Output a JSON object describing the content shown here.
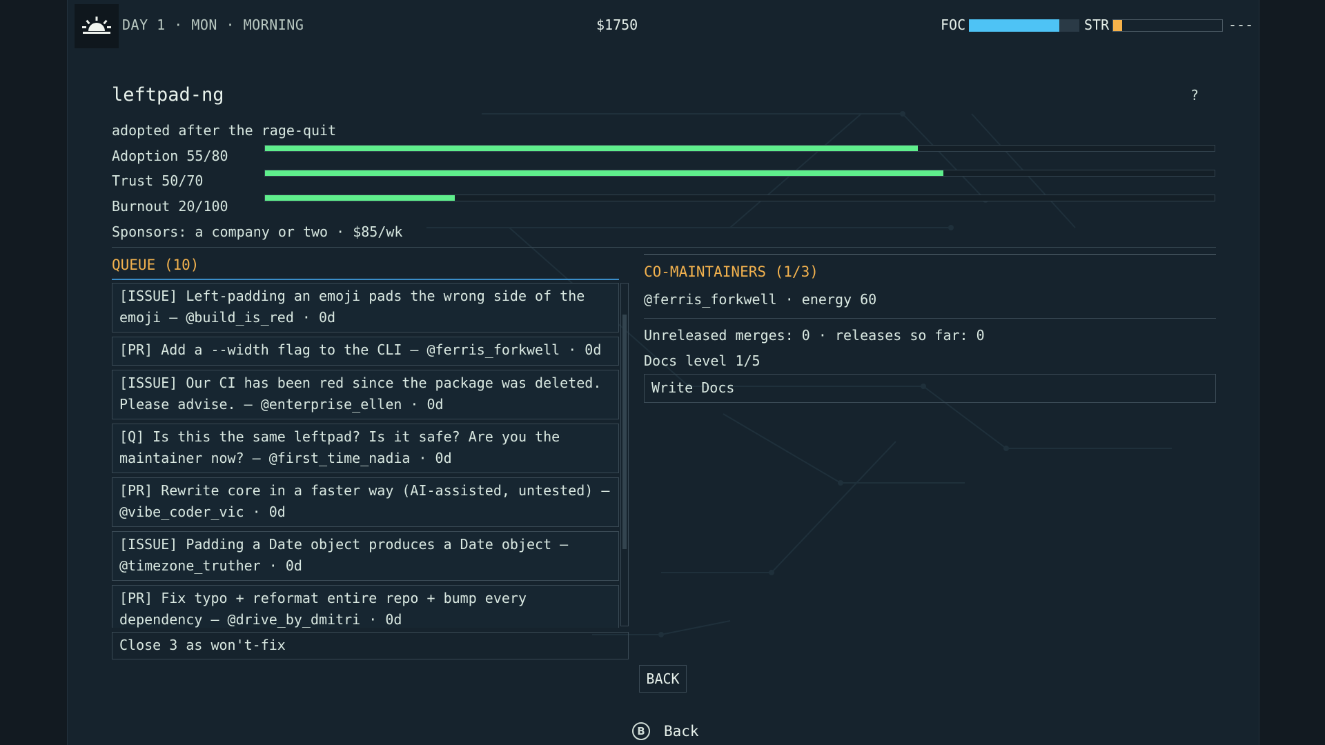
{
  "topbar": {
    "sun_icon": "sunrise-icon",
    "day_label": "DAY 1 · MON · MORNING",
    "money": "$1750",
    "focus_label": "FOC",
    "focus_level": 0.82,
    "focus_color": "#4ec3f5",
    "stress_label": "STR",
    "stress_level": 0.08,
    "stress_color": "#f7b24a",
    "dashes": "---"
  },
  "project": {
    "title": "leftpad-ng",
    "help": "?",
    "tagline": "adopted after the rage-quit",
    "stats": [
      {
        "label": "Adoption 55/80",
        "value": 55,
        "max": 80
      },
      {
        "label": "Trust 50/70",
        "value": 50,
        "max": 70
      },
      {
        "label": "Burnout 20/100",
        "value": 20,
        "max": 100
      }
    ],
    "stat_bar_color": "#5fee8c",
    "sponsors": "Sponsors: a company or two · $85/wk"
  },
  "queue": {
    "title": "QUEUE (10)",
    "items": [
      "[ISSUE] Left-padding an emoji pads the wrong side of the\nemoji — @build_is_red · 0d",
      "[PR] Add a --width flag to the CLI — @ferris_forkwell · 0d",
      "[ISSUE] Our CI has been red since the package was deleted.\nPlease advise. — @enterprise_ellen · 0d",
      "[Q] Is this the same leftpad? Is it safe? Are you the\nmaintainer now? — @first_time_nadia · 0d",
      "[PR] Rewrite core in a faster way (AI-assisted, untested) —\n@vibe_coder_vic · 0d",
      "[ISSUE] Padding a Date object produces a Date object —\n@timezone_truther · 0d",
      "[PR] Fix typo + reformat entire repo + bump every\ndependency — @drive_by_dmitri · 0d"
    ],
    "close_action": "Close 3 as won't-fix"
  },
  "co_maintainers": {
    "title": "CO-MAINTAINERS (1/3)",
    "member": "@ferris_forkwell · energy 60",
    "merges": "Unreleased merges: 0 · releases so far: 0",
    "docs_level": "Docs level 1/5",
    "write_docs": "Write Docs"
  },
  "footer": {
    "back_button": "BACK",
    "hint_icon": "b-button-icon",
    "hint_glyph": "B",
    "hint_label": "Back"
  },
  "colors": {
    "accent": "#f3b24e",
    "background": "#16232d"
  }
}
